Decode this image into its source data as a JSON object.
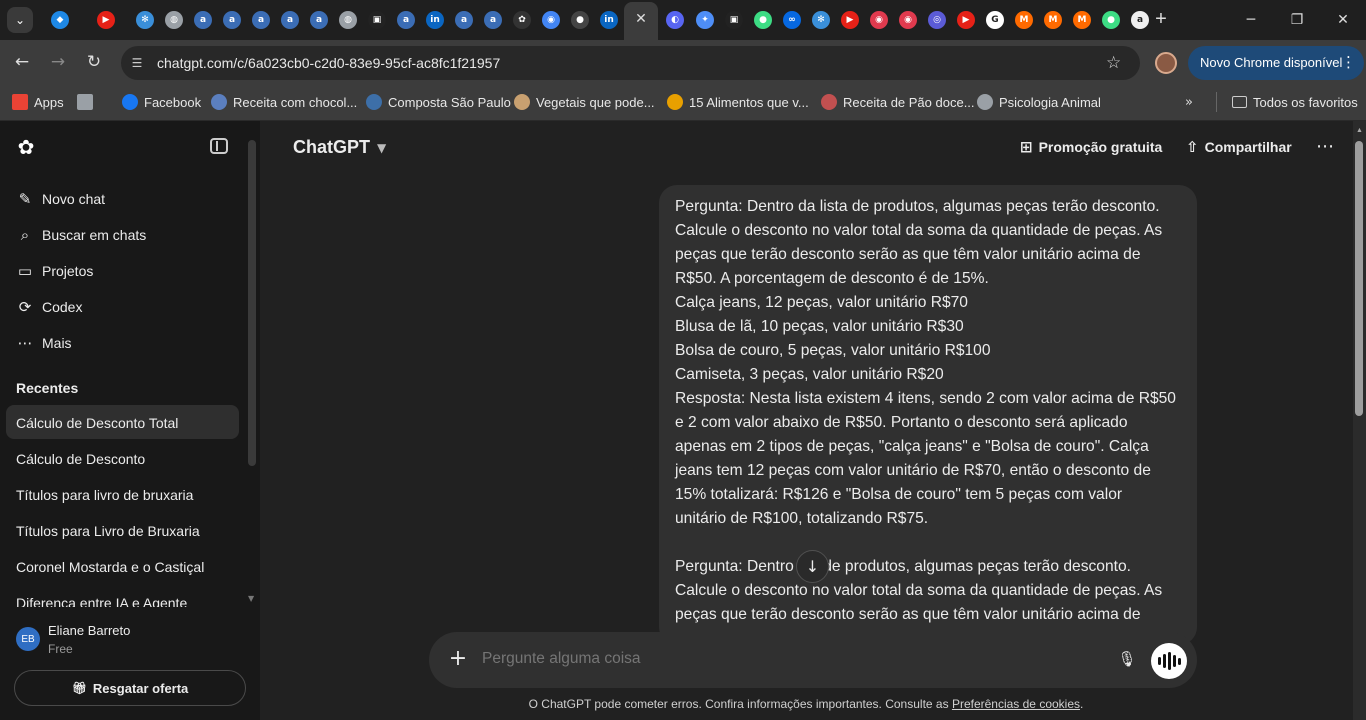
{
  "browser": {
    "tab_icons": [
      {
        "icon": "shield-icon",
        "color": "#1e88e5",
        "glyph": "◆"
      },
      {
        "icon": "youtube-icon",
        "color": "#e62117",
        "glyph": "▶"
      },
      {
        "icon": "react-icon",
        "color": "#3a8fd9",
        "glyph": "✻"
      },
      {
        "icon": "globe-icon",
        "color": "#9aa0a6",
        "glyph": "◍"
      },
      {
        "icon": "doc-icon",
        "color": "#3b6db5",
        "glyph": "a"
      },
      {
        "icon": "doc-icon",
        "color": "#3b6db5",
        "glyph": "a"
      },
      {
        "icon": "doc-icon",
        "color": "#3b6db5",
        "glyph": "a"
      },
      {
        "icon": "doc-icon",
        "color": "#3b6db5",
        "glyph": "a"
      },
      {
        "icon": "doc-icon",
        "color": "#3b6db5",
        "glyph": "a"
      },
      {
        "icon": "globe-icon",
        "color": "#9aa0a6",
        "glyph": "◍"
      },
      {
        "icon": "notion-icon",
        "color": "#222222",
        "glyph": "▣"
      },
      {
        "icon": "doc-icon",
        "color": "#3b6db5",
        "glyph": "a"
      },
      {
        "icon": "linkedin-icon",
        "color": "#0a66c2",
        "glyph": "in"
      },
      {
        "icon": "doc-icon",
        "color": "#3b6db5",
        "glyph": "a"
      },
      {
        "icon": "doc-icon",
        "color": "#3b6db5",
        "glyph": "a"
      },
      {
        "icon": "chatgpt-icon",
        "color": "#333333",
        "glyph": "✿"
      },
      {
        "icon": "browser-icon",
        "color": "#4285f4",
        "glyph": "◉"
      },
      {
        "icon": "github-icon",
        "color": "#444444",
        "glyph": "●"
      },
      {
        "icon": "linkedin-icon",
        "color": "#0a66c2",
        "glyph": "in"
      },
      {
        "icon": "power-icon",
        "color": "#5865f2",
        "glyph": "◐"
      },
      {
        "icon": "sparkle-icon",
        "color": "#4e8ef7",
        "glyph": "✦"
      },
      {
        "icon": "notion-icon",
        "color": "#222222",
        "glyph": "▣"
      },
      {
        "icon": "android-icon",
        "color": "#3ddc84",
        "glyph": "●"
      },
      {
        "icon": "meta-icon",
        "color": "#0668e1",
        "glyph": "∞"
      },
      {
        "icon": "react-icon",
        "color": "#3a8fd9",
        "glyph": "✻"
      },
      {
        "icon": "youtube-icon",
        "color": "#e62117",
        "glyph": "▶"
      },
      {
        "icon": "record-icon",
        "color": "#e03a4e",
        "glyph": "◉"
      },
      {
        "icon": "record-icon",
        "color": "#e03a4e",
        "glyph": "◉"
      },
      {
        "icon": "circle-icon",
        "color": "#5b5bd6",
        "glyph": "◎"
      },
      {
        "icon": "youtube-icon",
        "color": "#e62117",
        "glyph": "▶"
      },
      {
        "icon": "google-icon",
        "color": "#ffffff",
        "glyph": "G"
      },
      {
        "icon": "mail-icon",
        "color": "#ff6a00",
        "glyph": "M"
      },
      {
        "icon": "mail-icon",
        "color": "#ff6a00",
        "glyph": "M"
      },
      {
        "icon": "mail-icon",
        "color": "#ff6a00",
        "glyph": "M"
      },
      {
        "icon": "android-icon",
        "color": "#3ddc84",
        "glyph": "●"
      },
      {
        "icon": "amazon-icon",
        "color": "#f0f0f0",
        "glyph": "a"
      }
    ],
    "url": "chatgpt.com/c/6a023cb0-c2d0-83e9-95cf-ac8fc1f21957",
    "update_badge": "Novo Chrome disponível",
    "bookmarks": [
      {
        "label": "Apps",
        "icon": "apps-grid-icon",
        "color": "#ea4335"
      },
      {
        "label": "",
        "icon": "tab-groups-icon",
        "color": "#9aa0a6"
      },
      {
        "label": "Facebook",
        "icon": "facebook-icon",
        "color": "#1877f2"
      },
      {
        "label": "Receita com chocol...",
        "icon": "recipe-icon",
        "color": "#5b7fbf"
      },
      {
        "label": "Composta São Paulo",
        "icon": "wordpress-icon",
        "color": "#3d6fa8"
      },
      {
        "label": "Vegetais que pode...",
        "icon": "pet-icon",
        "color": "#c8a070"
      },
      {
        "label": "15 Alimentos que v...",
        "icon": "food-icon",
        "color": "#e8a000"
      },
      {
        "label": "Receita de Pão doce...",
        "icon": "bread-icon",
        "color": "#c25050"
      },
      {
        "label": "Psicologia Animal",
        "icon": "globe-icon",
        "color": "#9aa0a6"
      }
    ],
    "all_bookmarks": "Todos os favoritos"
  },
  "sidebar": {
    "nav": [
      {
        "label": "Novo chat",
        "icon": "edit-icon"
      },
      {
        "label": "Buscar em chats",
        "icon": "search-icon"
      },
      {
        "label": "Projetos",
        "icon": "folder-icon"
      },
      {
        "label": "Codex",
        "icon": "codex-icon"
      },
      {
        "label": "Mais",
        "icon": "more-icon"
      }
    ],
    "recents_title": "Recentes",
    "recents": [
      "Cálculo de Desconto Total",
      "Cálculo de Desconto",
      "Títulos para livro de bruxaria",
      "Títulos para Livro de Bruxaria",
      "Coronel Mostarda e o Castiçal",
      "Diferença entre IA e Agente"
    ],
    "user": {
      "initials": "EB",
      "name": "Eliane Barreto",
      "plan": "Free"
    },
    "offer_button": "Resgatar oferta"
  },
  "header": {
    "model": "ChatGPT",
    "promo": "Promoção gratuita",
    "share": "Compartilhar"
  },
  "message": {
    "lines": [
      "Pergunta: Dentro da lista de produtos, algumas peças terão desconto.",
      "Calcule o desconto no valor total da soma da quantidade de peças. As",
      "peças que terão desconto serão as que têm valor unitário acima de",
      "R$50. A porcentagem de desconto é de 15%.",
      "Calça jeans, 12 peças, valor unitário R$70",
      "Blusa de lã, 10 peças, valor unitário R$30",
      "Bolsa de couro, 5 peças, valor unitário R$100",
      "Camiseta, 3 peças, valor unitário R$20",
      "Resposta: Nesta lista existem 4 itens, sendo 2 com valor acima de R$50",
      "e 2 com valor abaixo de R$50. Portanto o desconto será aplicado",
      "apenas em 2 tipos de peças, \"calça jeans\" e \"Bolsa de couro\". Calça",
      "jeans tem 12 peças com valor unitário de R$70, então o desconto de",
      "15% totalizará: R$126 e \"Bolsa de couro\" tem 5 peças com valor",
      "unitário de R$100, totalizando R$75.",
      "",
      "Pergunta: Dentro      sta de produtos, algumas peças terão desconto.",
      "Calcule o desconto no valor total da soma da quantidade de peças. As",
      "peças que terão desconto serão as que têm valor unitário acima de"
    ]
  },
  "composer": {
    "placeholder": "Pergunte alguma coisa"
  },
  "footer": {
    "text": "O ChatGPT pode cometer erros. Confira informações importantes. Consulte as ",
    "link": "Preferências de cookies",
    "end": "."
  }
}
